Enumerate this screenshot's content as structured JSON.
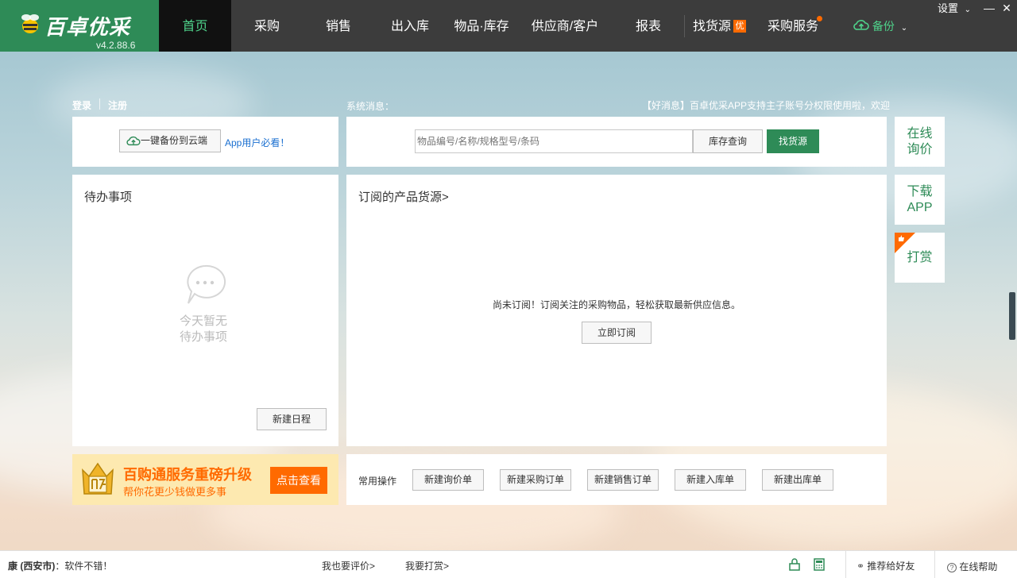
{
  "app": {
    "name": "百卓优采",
    "version": "v4.2.88.6"
  },
  "nav": {
    "items": [
      {
        "label": "首页",
        "active": true
      },
      {
        "label": "采购"
      },
      {
        "label": "销售"
      },
      {
        "label": "出入库"
      },
      {
        "label": "物品·库存"
      },
      {
        "label": "供应商/客户"
      },
      {
        "label": "报表"
      }
    ],
    "find_goods": "找货源",
    "find_goods_badge": "优",
    "purchase_service": "采购服务",
    "backup": "备份",
    "settings": "设置"
  },
  "account": {
    "login": "登录",
    "register": "注册"
  },
  "system": {
    "label": "系统消息：",
    "notice": "【好消息】百卓优采APP支持主子账号分权限使用啦，欢迎"
  },
  "backup_panel": {
    "button": "一键备份到云端",
    "app_note": "App用户必看！"
  },
  "search": {
    "placeholder": "物品编号/名称/规格型号/条码",
    "stock_query": "库存查询",
    "find_source": "找货源"
  },
  "todo": {
    "title": "待办事项",
    "empty_line1": "今天暂无",
    "empty_line2": "待办事项",
    "new_schedule": "新建日程"
  },
  "subscription": {
    "title": "订阅的产品货源>",
    "empty": "尚未订阅！订阅关注的采购物品，轻松获取最新供应信息。",
    "subscribe": "立即订阅"
  },
  "side": {
    "inquiry": [
      "在线",
      "询价"
    ],
    "download": [
      "下载",
      "APP"
    ],
    "reward": "打赏"
  },
  "promo": {
    "title": "百购通服务重磅升级",
    "subtitle": "帮你花更少钱做更多事",
    "button": "点击查看"
  },
  "common_ops": {
    "label": "常用操作",
    "buttons": [
      "新建询价单",
      "新建采购订单",
      "新建销售订单",
      "新建入库单",
      "新建出库单"
    ]
  },
  "status": {
    "review_prefix": "康 (西安市)",
    "review_text": "：软件不错！",
    "rate": "我也要评价>",
    "tip": "我要打赏>",
    "recommend": "推荐给好友",
    "help": "在线帮助"
  },
  "colors": {
    "brand": "#2e8b57",
    "accent": "#ff6a00",
    "topbar": "#3c3c3c"
  }
}
